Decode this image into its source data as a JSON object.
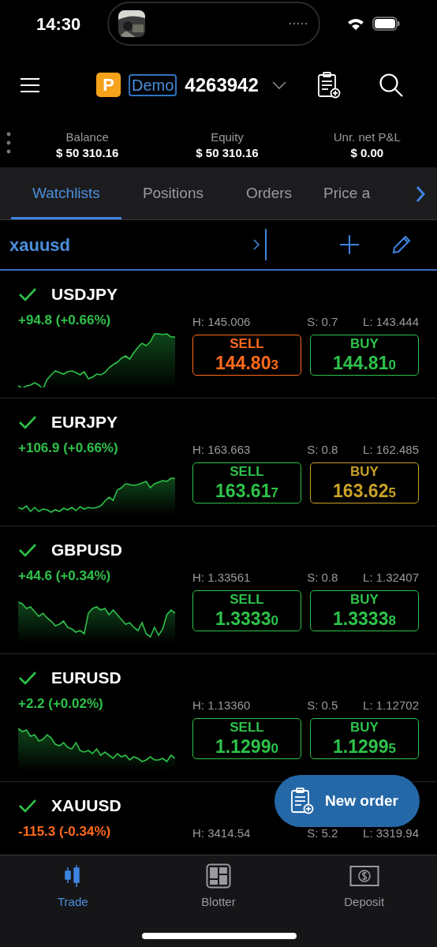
{
  "status_bar": {
    "time": "14:30"
  },
  "header": {
    "badge": "P",
    "mode": "Demo",
    "account": "4263942"
  },
  "summary": [
    {
      "label": "Balance",
      "value": "$ 50 310.16"
    },
    {
      "label": "Equity",
      "value": "$ 50 310.16"
    },
    {
      "label": "Unr. net P&L",
      "value": "$ 0.00"
    }
  ],
  "tabs": [
    {
      "label": "Watchlists",
      "selected": true
    },
    {
      "label": "Positions",
      "selected": false
    },
    {
      "label": "Orders",
      "selected": false
    },
    {
      "label": "Price a",
      "selected": false
    }
  ],
  "watchlist": {
    "name": "xauusd"
  },
  "instruments": [
    {
      "symbol": "USDJPY",
      "change": "+94.8 (+0.66%)",
      "color": "#2ec24a",
      "high": "H: 145.006",
      "spread": "S: 0.7",
      "low": "L: 143.444",
      "sell": {
        "label": "SELL",
        "price": "144.80",
        "last_digit": "3",
        "color": "#ff6a1c"
      },
      "buy": {
        "label": "BUY",
        "price": "144.81",
        "last_digit": "0",
        "color": "#2ec24a"
      }
    },
    {
      "symbol": "EURJPY",
      "change": "+106.9 (+0.66%)",
      "color": "#2ec24a",
      "high": "H: 163.663",
      "spread": "S: 0.8",
      "low": "L: 162.485",
      "sell": {
        "label": "SELL",
        "price": "163.61",
        "last_digit": "7",
        "color": "#2ec24a"
      },
      "buy": {
        "label": "BUY",
        "price": "163.62",
        "last_digit": "5",
        "color": "#c9a227"
      }
    },
    {
      "symbol": "GBPUSD",
      "change": "+44.6 (+0.34%)",
      "color": "#2ec24a",
      "high": "H: 1.33561",
      "spread": "S: 0.8",
      "low": "L: 1.32407",
      "sell": {
        "label": "SELL",
        "price": "1.3333",
        "last_digit": "0",
        "color": "#2ec24a"
      },
      "buy": {
        "label": "BUY",
        "price": "1.3333",
        "last_digit": "8",
        "color": "#2ec24a"
      }
    },
    {
      "symbol": "EURUSD",
      "change": "+2.2 (+0.02%)",
      "color": "#2ec24a",
      "high": "H: 1.13360",
      "spread": "S: 0.5",
      "low": "L: 1.12702",
      "sell": {
        "label": "SELL",
        "price": "1.1299",
        "last_digit": "0",
        "color": "#2ec24a"
      },
      "buy": {
        "label": "BUY",
        "price": "1.1299",
        "last_digit": "5",
        "color": "#2ec24a"
      }
    },
    {
      "symbol": "XAUUSD",
      "change": "-115.3 (-0.34%)",
      "color": "#ff6a1c",
      "high": "H: 3414.54",
      "spread": "S: 5.2",
      "low": "L: 3319.94"
    }
  ],
  "new_order": {
    "label": "New order"
  },
  "bottom_nav": [
    {
      "label": "Trade",
      "selected": true
    },
    {
      "label": "Blotter",
      "selected": false
    },
    {
      "label": "Deposit",
      "selected": false
    }
  ]
}
